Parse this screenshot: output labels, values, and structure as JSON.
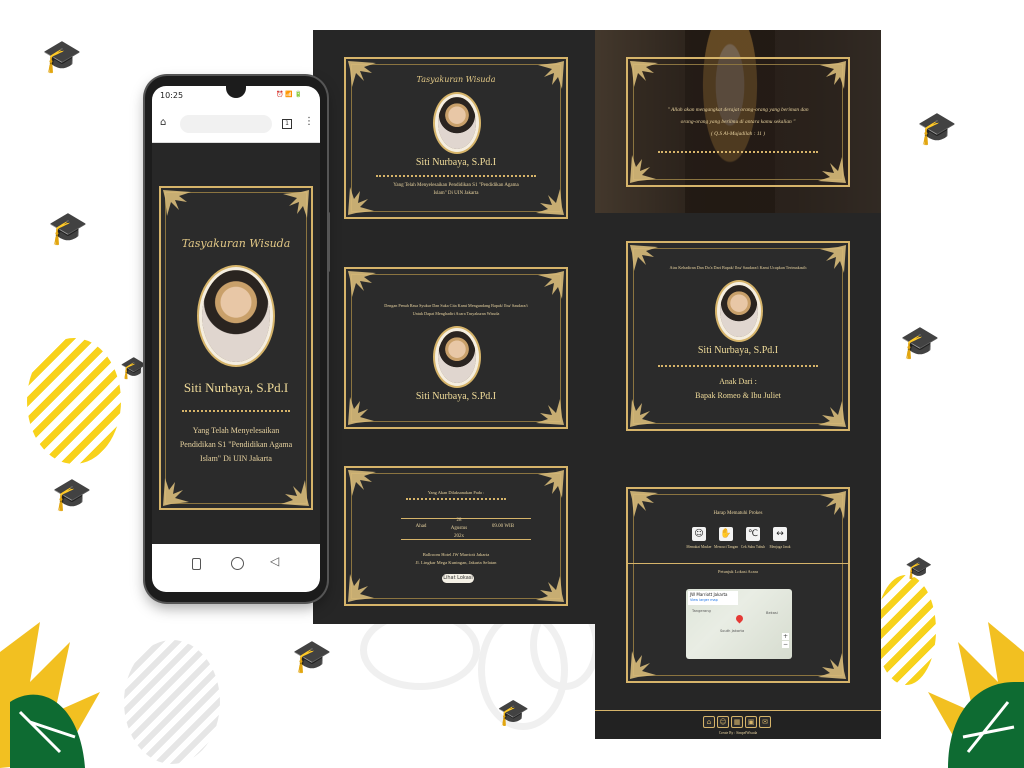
{
  "phone": {
    "status_time": "10:25",
    "status_icons": "⏰ 📶 🔋",
    "tab_count": "1",
    "card_title": "Tasyakuran Wisuda",
    "name": "Siti Nurbaya, S.Pd.I",
    "desc_line1": "Yang Telah Menyelesaikan",
    "desc_line2": "Pendidikan S1 \"Pendidikan Agama",
    "desc_line3": "Islam\" Di UIN Jakarta"
  },
  "panels": {
    "cover": {
      "title": "Tasyakuran Wisuda",
      "name": "Siti Nurbaya, S.Pd.I",
      "desc_line1": "Yang Telah Menyelesaikan Pendidikan S1 \"Pendidikan Agama",
      "desc_line2": "Islam\" Di UIN Jakarta"
    },
    "quote": {
      "line1": "\" Allah akan mengangkat derajat orang-orang yang beriman dan",
      "line2": "orang-orang yang berilmu di antara kamu sekalian \"",
      "line3": "( Q.S Al-Mujadilah : 11 )"
    },
    "greeting": {
      "line1": "Dengan Penuh Rasa Syukur Dan Suka Cita Kami Mengundang Bapak/ Ibu/ Saudara/i",
      "line2": "Untuk Dapat Menghadiri Acara Tasyakuran Wisuda",
      "name": "Siti Nurbaya, S.Pd.I"
    },
    "parents": {
      "intro": "Atas Kehadiran Dan Do'a Dari Bapak/ Ibu/ Saudara/i Kami Ucapkan Terimakasih",
      "name": "Siti Nurbaya, S.Pd.I",
      "child_of": "Anak Dari :",
      "parents_names": "Bapak Romeo & Ibu Juliet"
    },
    "event": {
      "intro": "Yang Akan Dilaksanakan Pada :",
      "day": "Ahad",
      "date": "28",
      "month": "Agustus",
      "year": "202x",
      "time": "09.00 WIB",
      "venue": "Ballroom Hotel JW Marriott Jakarta",
      "address": "Jl. Lingkar Mega Kuningan, Jakarta Selatan",
      "button": "Lihat Lokasi"
    },
    "health": {
      "title": "Harap Mematuhi Prokes",
      "items": [
        "Memakai Masker",
        "Mencuci Tangan",
        "Cek Suhu Tubuh",
        "Menjaga Jarak"
      ],
      "map_title": "Petunjuk Lokasi Acara",
      "map_label": "JW Marriott Jakarta",
      "map_link": "View larger map",
      "map_city": "Tangerang",
      "map_area": "South Jakarta",
      "map_area2": "Bekasi"
    },
    "footer": {
      "credit": "Create By : SimpelWisuda"
    }
  }
}
